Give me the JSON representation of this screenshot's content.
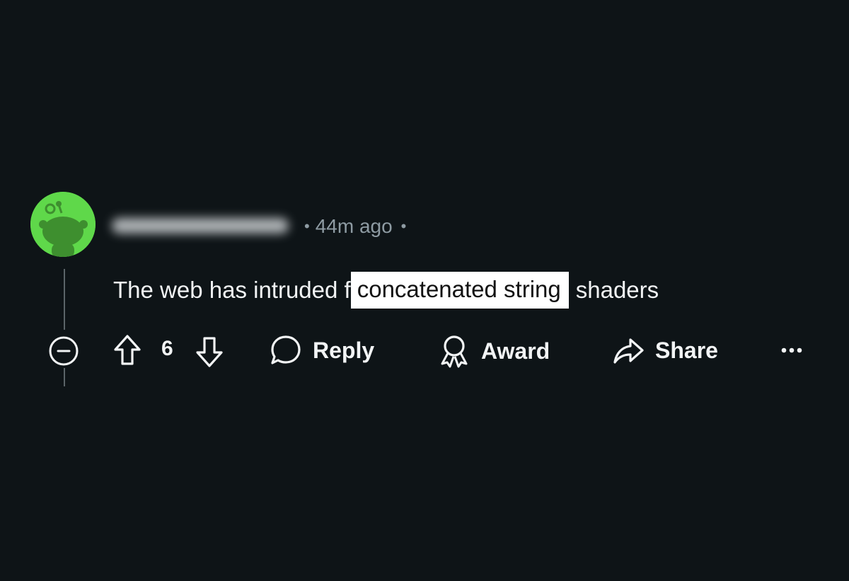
{
  "comment": {
    "avatar_icon": "reddit-snoo-avatar-icon",
    "avatar_color": "#5fd84a",
    "username_redacted": true,
    "separator": "•",
    "timestamp": "44m ago",
    "body_before": "The web has intruded f",
    "body_highlight": "concatenated string",
    "body_after": "shaders",
    "highlight_color": "#ffffff"
  },
  "actions": {
    "collapse_icon": "minus-circle-icon",
    "upvote_icon": "arrow-up-icon",
    "score": "6",
    "downvote_icon": "arrow-down-icon",
    "reply_label": "Reply",
    "reply_icon": "speech-bubble-icon",
    "award_label": "Award",
    "award_icon": "award-ribbon-icon",
    "share_label": "Share",
    "share_icon": "share-arrow-icon",
    "more_icon": "ellipsis-icon"
  },
  "theme": {
    "background": "#0e1417",
    "text": "#f2f4f5",
    "muted_text": "#8e9ba3",
    "thread_line": "#5b6468"
  }
}
